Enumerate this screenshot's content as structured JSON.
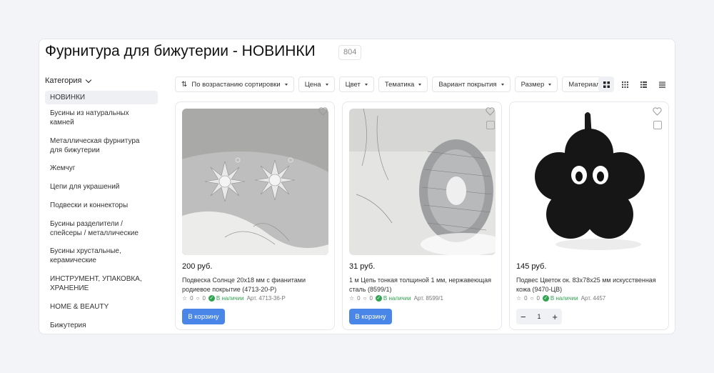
{
  "page": {
    "title": "Фурнитура для бижутерии - НОВИНКИ",
    "count": "804"
  },
  "sidebar": {
    "header": "Категория",
    "items": [
      {
        "label": "НОВИНКИ",
        "active": true
      },
      {
        "label": "Бусины из натуральных камней"
      },
      {
        "label": "Металлическая фурнитура для бижутерии"
      },
      {
        "label": "Жемчуг"
      },
      {
        "label": "Цепи для украшений"
      },
      {
        "label": "Подвески и коннекторы"
      },
      {
        "label": "Бусины разделители / спейсеры / металлические"
      },
      {
        "label": "Бусины хрустальные, керамические"
      },
      {
        "label": "ИНСТРУМЕНТ, УПАКОВКА, ХРАНЕНИЕ"
      },
      {
        "label": "HOME & BEAUTY"
      },
      {
        "label": "Бижутерия"
      }
    ]
  },
  "filters": {
    "sort": "По возрастанию сортировки",
    "price": "Цена",
    "color": "Цвет",
    "theme": "Тематика",
    "coating": "Вариант покрытия",
    "size": "Размер",
    "material": "Материал"
  },
  "view_modes": [
    "grid-large-icon",
    "grid-small-icon",
    "list-icon",
    "compact-list-icon"
  ],
  "products": [
    {
      "price": "200 руб.",
      "name": "Подвеска Солнце 20х18 мм с фианитами родиевое покрытие (4713-20-Р)",
      "rating": "0",
      "reviews": "0",
      "stock": "В наличии",
      "sku": "Арт. 4713-36-Р",
      "cart": "В корзину"
    },
    {
      "price": "31 руб.",
      "name": "1 м Цепь тонкая толщиной 1 мм, нержавеющая сталь (8599/1)",
      "rating": "0",
      "reviews": "0",
      "stock": "В наличии",
      "sku": "Арт. 8599/1",
      "cart": "В корзину"
    },
    {
      "price": "145 руб.",
      "name": "Подвес Цветок ок. 83х78х25 мм искусственная кожа (9470-ЦВ)",
      "rating": "0",
      "reviews": "0",
      "stock": "В наличии",
      "sku": "Арт. 4457",
      "qty": "1"
    }
  ],
  "colors": {
    "accent": "#4a86e8",
    "stock": "#2ea44f"
  }
}
